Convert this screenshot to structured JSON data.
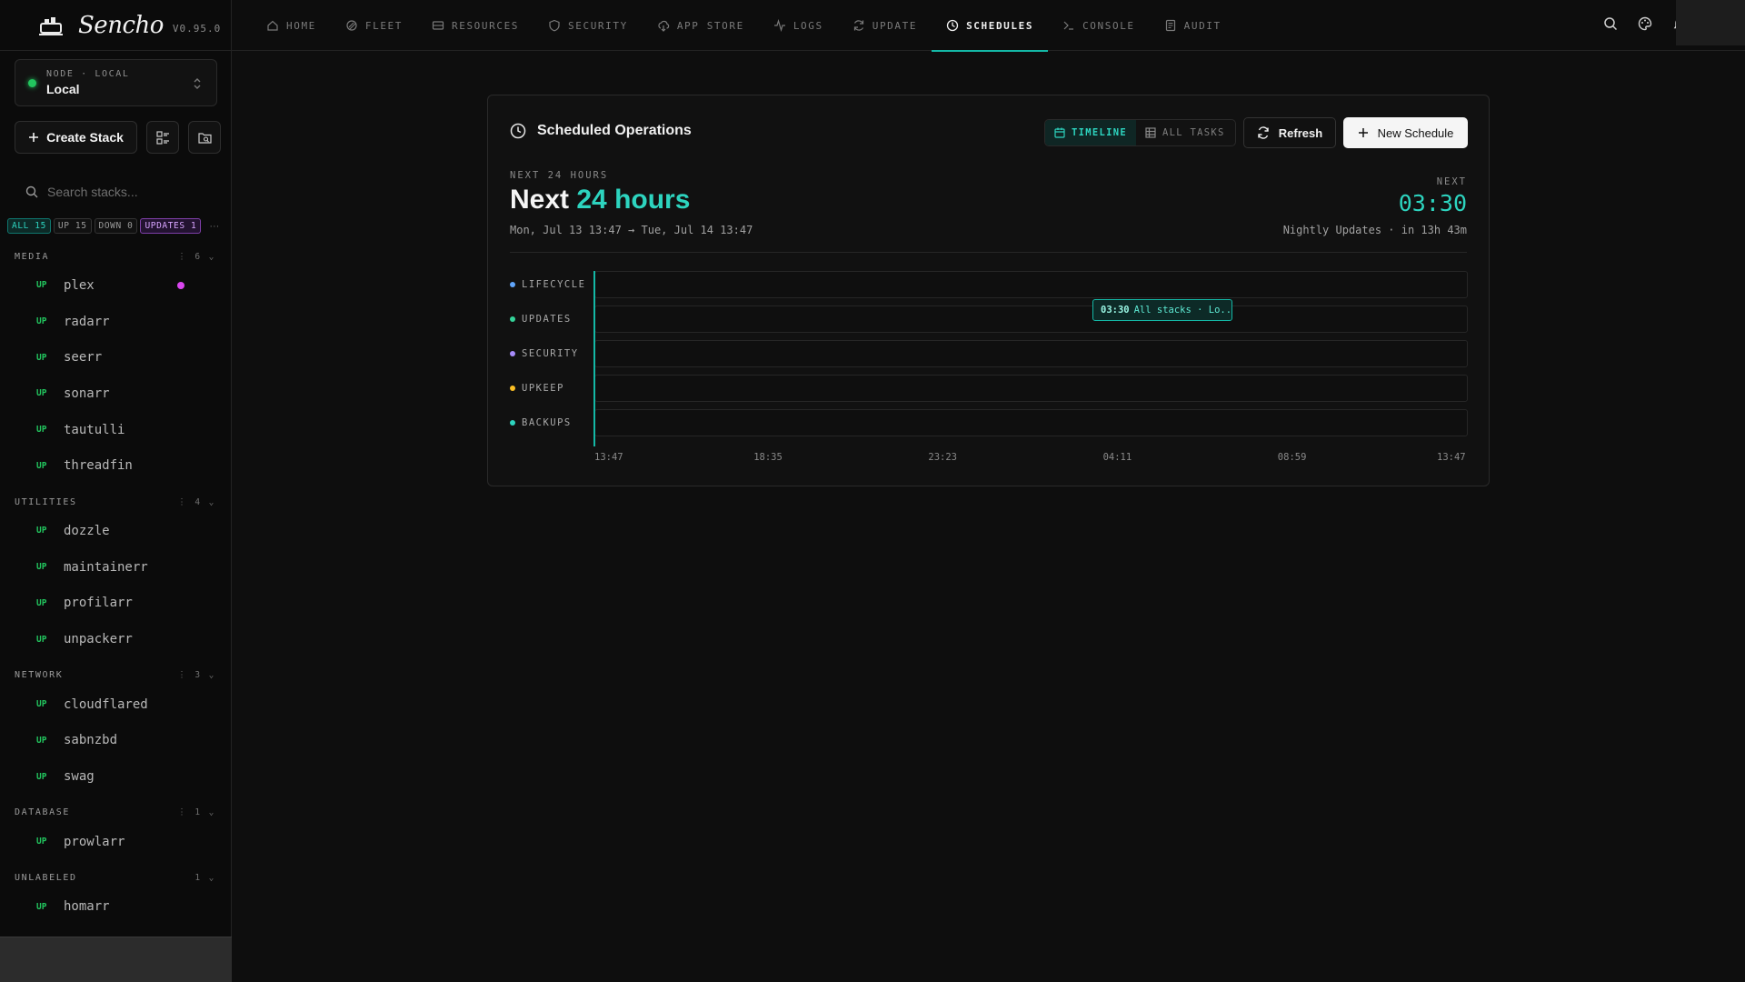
{
  "brand": {
    "name": "Sencho",
    "version": "V0.95.0"
  },
  "node": {
    "kicker": "NODE · LOCAL",
    "name": "Local"
  },
  "sidebar": {
    "create_label": "Create Stack",
    "search_placeholder": "Search stacks...",
    "filters": [
      {
        "label": "ALL 15"
      },
      {
        "label": "UP 15"
      },
      {
        "label": "DOWN 0"
      },
      {
        "label": "UPDATES 1"
      }
    ],
    "more": "···",
    "groups": [
      {
        "name": "MEDIA",
        "count": "6",
        "stacks": [
          {
            "status": "UP",
            "name": "plex",
            "flag": true
          },
          {
            "status": "UP",
            "name": "radarr"
          },
          {
            "status": "UP",
            "name": "seerr"
          },
          {
            "status": "UP",
            "name": "sonarr"
          },
          {
            "status": "UP",
            "name": "tautulli"
          },
          {
            "status": "UP",
            "name": "threadfin"
          }
        ]
      },
      {
        "name": "UTILITIES",
        "count": "4",
        "stacks": [
          {
            "status": "UP",
            "name": "dozzle"
          },
          {
            "status": "UP",
            "name": "maintainerr"
          },
          {
            "status": "UP",
            "name": "profilarr"
          },
          {
            "status": "UP",
            "name": "unpackerr"
          }
        ]
      },
      {
        "name": "NETWORK",
        "count": "3",
        "stacks": [
          {
            "status": "UP",
            "name": "cloudflared"
          },
          {
            "status": "UP",
            "name": "sabnzbd"
          },
          {
            "status": "UP",
            "name": "swag"
          }
        ]
      },
      {
        "name": "DATABASE",
        "count": "1",
        "stacks": [
          {
            "status": "UP",
            "name": "prowlarr"
          }
        ]
      },
      {
        "name": "UNLABELED",
        "count": "1",
        "stacks": [
          {
            "status": "UP",
            "name": "homarr"
          }
        ]
      }
    ]
  },
  "nav": {
    "tabs": [
      {
        "label": "HOME",
        "icon": "home-icon"
      },
      {
        "label": "FLEET",
        "icon": "fleet-icon"
      },
      {
        "label": "RESOURCES",
        "icon": "resources-icon"
      },
      {
        "label": "SECURITY",
        "icon": "shield-icon"
      },
      {
        "label": "APP STORE",
        "icon": "cloud-download-icon"
      },
      {
        "label": "LOGS",
        "icon": "activity-icon"
      },
      {
        "label": "UPDATE",
        "icon": "refresh-icon"
      },
      {
        "label": "SCHEDULES",
        "icon": "clock-icon",
        "active": true
      },
      {
        "label": "CONSOLE",
        "icon": "terminal-icon"
      },
      {
        "label": "AUDIT",
        "icon": "audit-icon"
      }
    ]
  },
  "schedules": {
    "title": "Scheduled Operations",
    "view_timeline": "TIMELINE",
    "view_all": "ALL TASKS",
    "refresh_label": "Refresh",
    "new_label": "New Schedule",
    "kicker": "NEXT 24 HOURS",
    "headline_prefix": "Next",
    "headline_accent": "24 hours",
    "range": "Mon, Jul 13 13:47 → Tue, Jul 14 13:47",
    "next_kicker": "NEXT",
    "next_time": "03:30",
    "next_desc": "Nightly Updates · in 13h 43m",
    "lanes": [
      {
        "label": "LIFECYCLE",
        "color": "#60a5fa"
      },
      {
        "label": "UPDATES",
        "color": "#34d399"
      },
      {
        "label": "SECURITY",
        "color": "#a78bfa"
      },
      {
        "label": "UPKEEP",
        "color": "#fbbf24"
      },
      {
        "label": "BACKUPS",
        "color": "#2dd4bf"
      }
    ],
    "event": {
      "time": "03:30",
      "text": "All stacks · Lo..."
    },
    "ticks": [
      "13:47",
      "18:35",
      "23:23",
      "04:11",
      "08:59",
      "13:47"
    ]
  },
  "colors": {
    "accent": "#14b8a6",
    "up": "#22c55e",
    "update_flag": "#d946ef"
  }
}
